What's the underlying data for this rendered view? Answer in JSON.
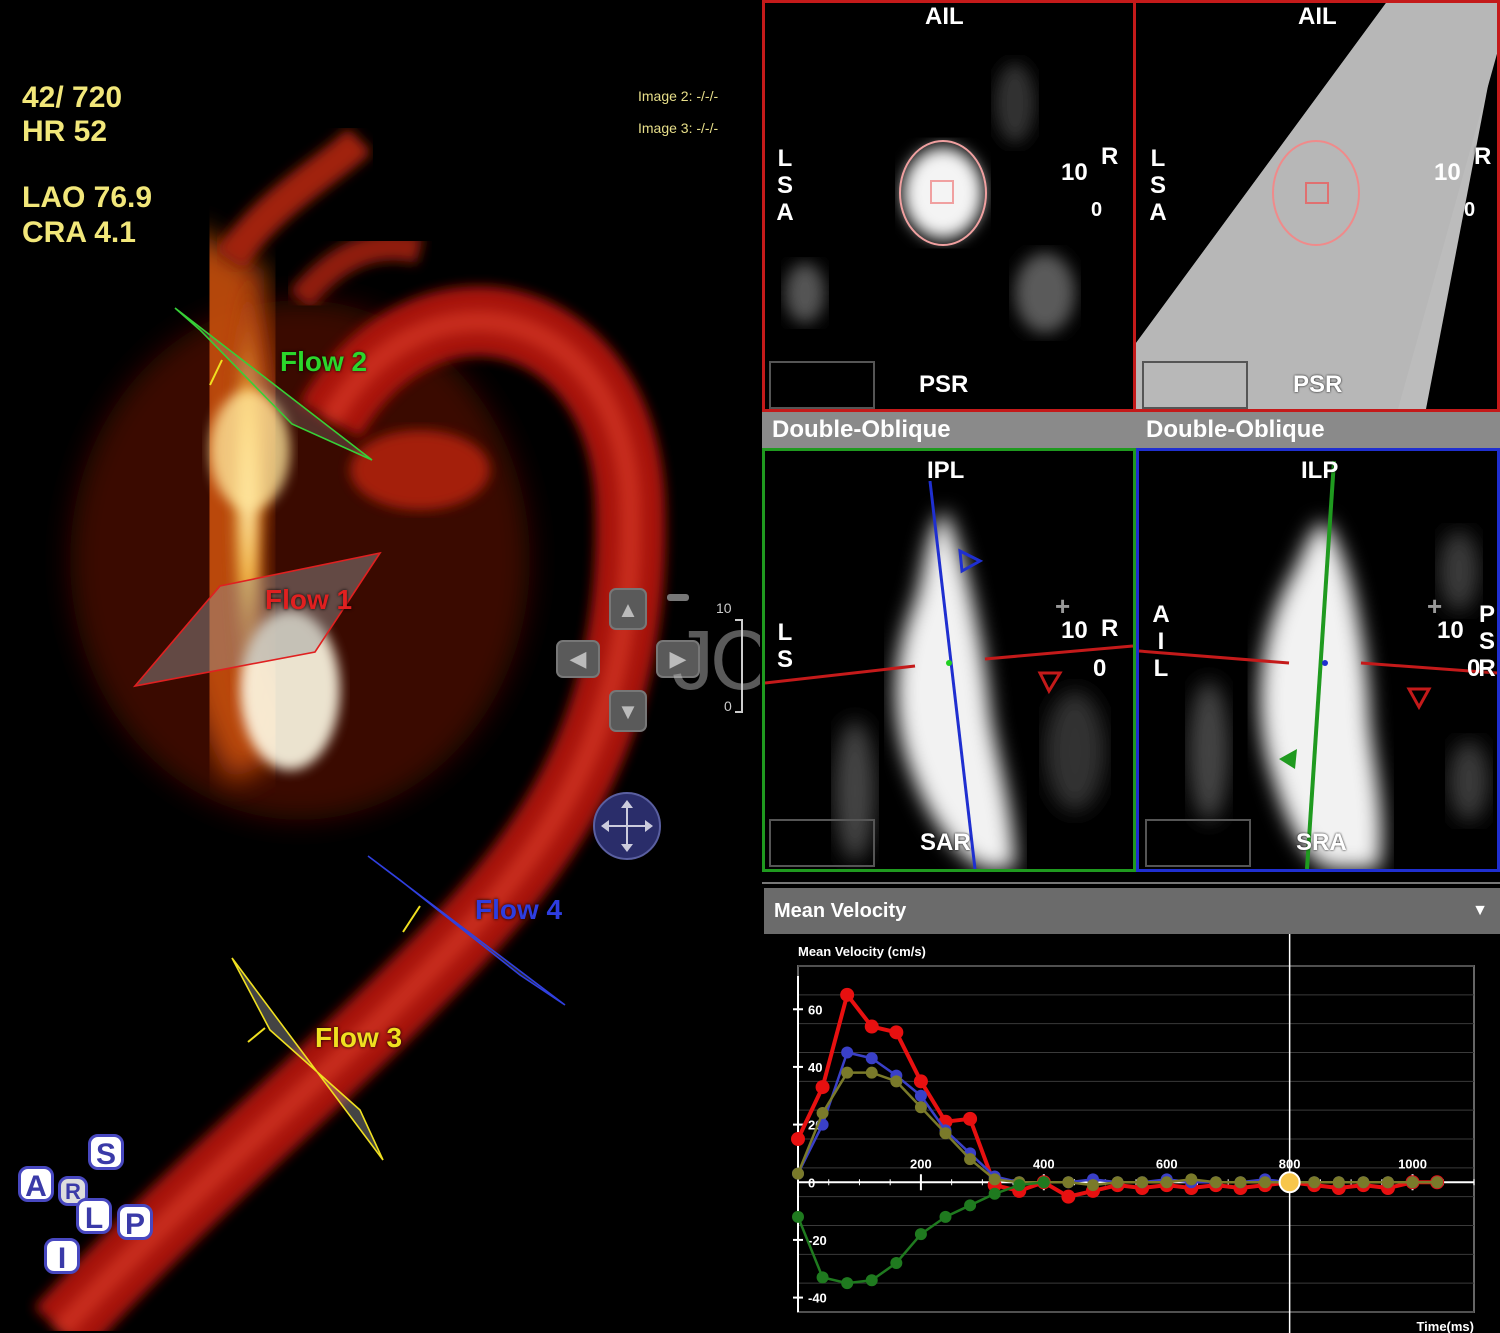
{
  "viewer3d": {
    "frame": "42/ 720",
    "hr": "HR 52",
    "lao": "LAO 76.9",
    "cra": "CRA 4.1",
    "image2": "Image 2: -/-/-",
    "image3": "Image 3: -/-/-",
    "scale_top": "10",
    "scale_bottom": "0",
    "watermark": "JCC",
    "flows": [
      {
        "label": "Flow 2",
        "color": "#2bd62b"
      },
      {
        "label": "Flow 1",
        "color": "#e02020"
      },
      {
        "label": "Flow 4",
        "color": "#2e3de0"
      },
      {
        "label": "Flow 3",
        "color": "#f0e020"
      }
    ],
    "orientation_cube": {
      "s": "S",
      "a": "A",
      "l": "L",
      "p": "P",
      "i": "I",
      "r": "R"
    },
    "nav_icons": [
      "arrow-up-icon",
      "arrow-left-icon",
      "arrow-right-icon",
      "arrow-down-icon",
      "minus-icon",
      "move-icon"
    ]
  },
  "panels": {
    "top_left": {
      "top": "AIL",
      "bottom": "PSR",
      "left": "LSA",
      "scale": "10",
      "right": "R",
      "zero": "0"
    },
    "top_right": {
      "top": "AIL",
      "bottom": "PSR",
      "left": "LSA",
      "scale": "10",
      "right": "R",
      "zero": "0"
    },
    "header_left": "Double-Oblique",
    "header_right": "Double-Oblique",
    "mid_left": {
      "top": "IPL",
      "bottom": "SAR",
      "left": "LS",
      "scale": "10",
      "right": "R",
      "zero": "0"
    },
    "mid_right": {
      "top": "ILP",
      "bottom": "SRA",
      "left": "AIL",
      "scale": "10",
      "right": "PSR",
      "zero": "0"
    },
    "colors": {
      "red": "#c41a1a",
      "green": "#1f9a1f",
      "blue": "#1f2fd0"
    }
  },
  "chart_header": "Mean Velocity",
  "chart_data": {
    "type": "line",
    "title": "",
    "ylabel": "Mean Velocity (cm/s)",
    "xlabel": "Time(ms)",
    "xlim": [
      0,
      1100
    ],
    "ylim": [
      -45,
      75
    ],
    "x_ticks": [
      200,
      400,
      600,
      800,
      1000
    ],
    "y_ticks": [
      -40,
      -20,
      20,
      40,
      60
    ],
    "cursor_x": 800,
    "series": [
      {
        "color": "#e81010",
        "x": [
          0,
          40,
          80,
          120,
          160,
          200,
          240,
          280,
          320,
          360,
          400,
          440,
          480,
          520,
          560,
          600,
          640,
          680,
          720,
          760,
          800,
          840,
          880,
          920,
          960,
          1000,
          1040
        ],
        "y": [
          15,
          33,
          65,
          54,
          52,
          35,
          21,
          22,
          -1,
          -3,
          0,
          -5,
          -3,
          -1,
          -2,
          -1,
          -2,
          -1,
          -2,
          -1,
          0,
          -1,
          -2,
          -1,
          -2,
          0,
          0
        ]
      },
      {
        "color": "#3a40c8",
        "x": [
          0,
          40,
          80,
          120,
          160,
          200,
          240,
          280,
          320,
          360,
          400,
          440,
          480,
          520,
          560,
          600,
          640,
          680,
          720,
          760,
          800,
          840,
          880,
          920,
          960,
          1000,
          1040
        ],
        "y": [
          3,
          20,
          45,
          43,
          37,
          30,
          18,
          10,
          2,
          0,
          0,
          0,
          1,
          0,
          0,
          1,
          0,
          0,
          0,
          1,
          0,
          0,
          0,
          0,
          0,
          0,
          0
        ]
      },
      {
        "color": "#7a7a2a",
        "x": [
          0,
          40,
          80,
          120,
          160,
          200,
          240,
          280,
          320,
          360,
          400,
          440,
          480,
          520,
          560,
          600,
          640,
          680,
          720,
          760,
          800,
          840,
          880,
          920,
          960,
          1000,
          1040
        ],
        "y": [
          3,
          24,
          38,
          38,
          35,
          26,
          17,
          8,
          1,
          0,
          0,
          0,
          -1,
          0,
          0,
          0,
          1,
          0,
          0,
          0,
          0,
          0,
          0,
          0,
          0,
          0,
          0
        ]
      },
      {
        "color": "#1f7a1f",
        "x": [
          0,
          40,
          80,
          120,
          160,
          200,
          240,
          280,
          320,
          360,
          400
        ],
        "y": [
          -12,
          -33,
          -35,
          -34,
          -28,
          -18,
          -12,
          -8,
          -4,
          -1,
          0
        ]
      }
    ]
  }
}
